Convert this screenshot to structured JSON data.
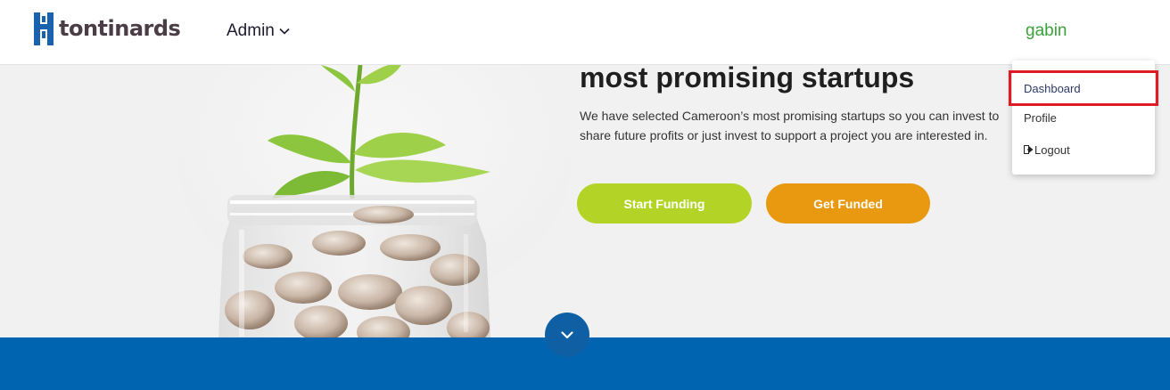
{
  "brand": {
    "name": "tontinards",
    "logo_color": "#1a62ad",
    "text_color": "#4a3d46"
  },
  "nav": {
    "admin_label": "Admin",
    "user_label": "gabin",
    "user_color": "#3aa23a"
  },
  "hero": {
    "title": "most promising startups",
    "description": "We have selected Cameroon’s most promising startups so you can invest to share future profits or just invest to support a project you are interested in.",
    "start_funding_label": "Start Funding",
    "get_funded_label": "Get Funded",
    "start_funding_color": "#b3d426",
    "get_funded_color": "#e8990f"
  },
  "dropdown": {
    "items": [
      {
        "label": "Dashboard",
        "highlighted": true
      },
      {
        "label": "Profile"
      },
      {
        "label": "Logout",
        "icon": "logout-icon"
      }
    ],
    "highlight_color": "#e01b24"
  },
  "band_color": "#0064b0",
  "scroll_icon": "chevron-down-icon"
}
